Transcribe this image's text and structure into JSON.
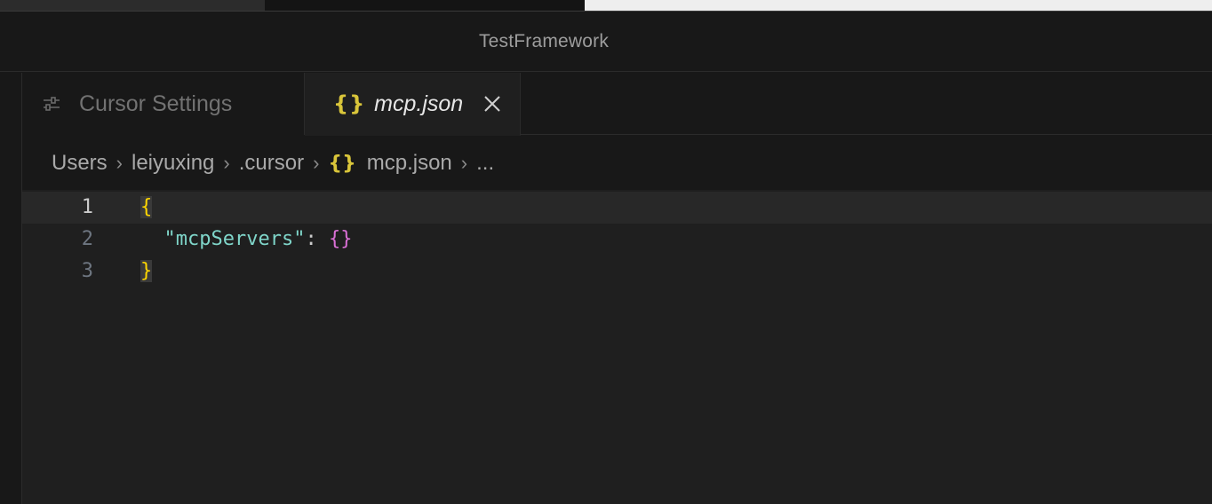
{
  "window": {
    "title": "TestFramework"
  },
  "tabs": [
    {
      "label": "Cursor Settings",
      "icon": "settings-sliders-icon",
      "active": false
    },
    {
      "label": "mcp.json",
      "icon": "json-braces-icon",
      "icon_text": "{}",
      "active": true
    }
  ],
  "breadcrumb": {
    "items": [
      "Users",
      "leiyuxing",
      ".cursor",
      "mcp.json",
      "..."
    ],
    "file_icon_text": "{}"
  },
  "editor": {
    "lines": [
      {
        "number": "1",
        "text": "{"
      },
      {
        "number": "2",
        "key": "\"mcpServers\"",
        "colon": ":",
        "value": "{}"
      },
      {
        "number": "3",
        "text": "}"
      }
    ]
  },
  "colors": {
    "background": "#181818",
    "editor_background": "#1f1f1f",
    "json_icon": "#d9c53a",
    "brace_level1": "#ffd700",
    "brace_level2": "#da70d6",
    "key": "#7fd5c9"
  }
}
